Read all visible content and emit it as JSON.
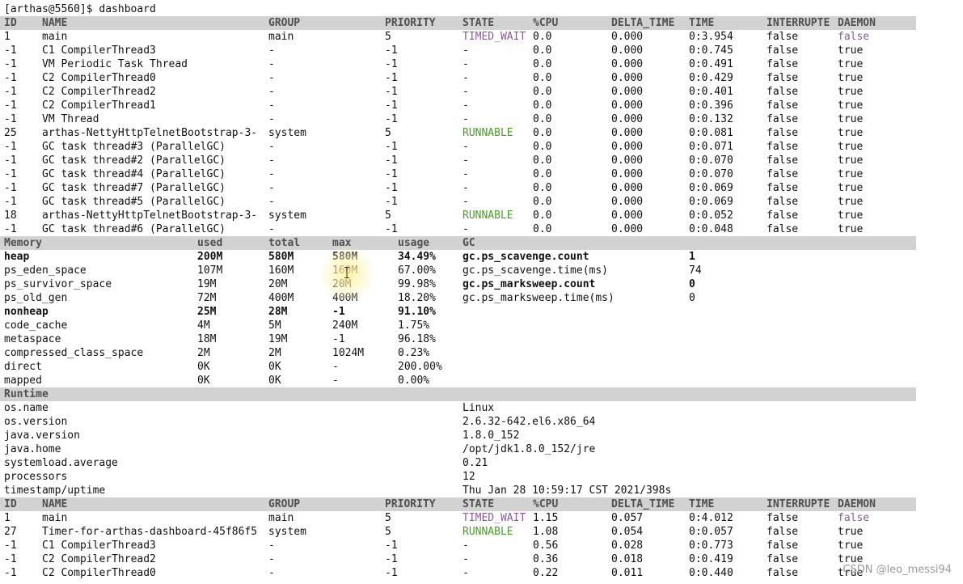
{
  "terminal": {
    "prompt": "[arthas@5560]$ dashboard"
  },
  "threads_top": {
    "headers": [
      "ID",
      "NAME",
      "GROUP",
      "PRIORITY",
      "STATE",
      "%CPU",
      "DELTA_TIME",
      "TIME",
      "INTERRUPTE",
      "DAEMON"
    ],
    "rows": [
      [
        "1",
        "main",
        "main",
        "5",
        "TIMED_WAIT",
        "0.0",
        "0.000",
        "0:3.954",
        "false",
        "false"
      ],
      [
        "-1",
        "C1 CompilerThread3",
        "-",
        "-1",
        "-",
        "0.0",
        "0.000",
        "0:0.745",
        "false",
        "true"
      ],
      [
        "-1",
        "VM Periodic Task Thread",
        "-",
        "-1",
        "-",
        "0.0",
        "0.000",
        "0:0.491",
        "false",
        "true"
      ],
      [
        "-1",
        "C2 CompilerThread0",
        "-",
        "-1",
        "-",
        "0.0",
        "0.000",
        "0:0.429",
        "false",
        "true"
      ],
      [
        "-1",
        "C2 CompilerThread2",
        "-",
        "-1",
        "-",
        "0.0",
        "0.000",
        "0:0.401",
        "false",
        "true"
      ],
      [
        "-1",
        "C2 CompilerThread1",
        "-",
        "-1",
        "-",
        "0.0",
        "0.000",
        "0:0.396",
        "false",
        "true"
      ],
      [
        "-1",
        "VM Thread",
        "-",
        "-1",
        "-",
        "0.0",
        "0.000",
        "0:0.132",
        "false",
        "true"
      ],
      [
        "25",
        "arthas-NettyHttpTelnetBootstrap-3-",
        "system",
        "5",
        "RUNNABLE",
        "0.0",
        "0.000",
        "0:0.081",
        "false",
        "true"
      ],
      [
        "-1",
        "GC task thread#3 (ParallelGC)",
        "-",
        "-1",
        "-",
        "0.0",
        "0.000",
        "0:0.071",
        "false",
        "true"
      ],
      [
        "-1",
        "GC task thread#2 (ParallelGC)",
        "-",
        "-1",
        "-",
        "0.0",
        "0.000",
        "0:0.070",
        "false",
        "true"
      ],
      [
        "-1",
        "GC task thread#4 (ParallelGC)",
        "-",
        "-1",
        "-",
        "0.0",
        "0.000",
        "0:0.070",
        "false",
        "true"
      ],
      [
        "-1",
        "GC task thread#7 (ParallelGC)",
        "-",
        "-1",
        "-",
        "0.0",
        "0.000",
        "0:0.069",
        "false",
        "true"
      ],
      [
        "-1",
        "GC task thread#5 (ParallelGC)",
        "-",
        "-1",
        "-",
        "0.0",
        "0.000",
        "0:0.069",
        "false",
        "true"
      ],
      [
        "18",
        "arthas-NettyHttpTelnetBootstrap-3-",
        "system",
        "5",
        "RUNNABLE",
        "0.0",
        "0.000",
        "0:0.052",
        "false",
        "true"
      ],
      [
        "-1",
        "GC task thread#6 (ParallelGC)",
        "-",
        "-1",
        "-",
        "0.0",
        "0.000",
        "0:0.048",
        "false",
        "true"
      ]
    ]
  },
  "memory": {
    "headers": [
      "Memory",
      "used",
      "total",
      "max",
      "usage",
      "GC"
    ],
    "rows": [
      {
        "cells": [
          "heap",
          "200M",
          "580M",
          "580M",
          "34.49%"
        ],
        "bold": true
      },
      {
        "cells": [
          "ps_eden_space",
          "107M",
          "160M",
          "160M",
          "67.00%"
        ],
        "bold": false
      },
      {
        "cells": [
          "ps_survivor_space",
          "19M",
          "20M",
          "20M",
          "99.98%"
        ],
        "bold": false
      },
      {
        "cells": [
          "ps_old_gen",
          "72M",
          "400M",
          "400M",
          "18.20%"
        ],
        "bold": false
      },
      {
        "cells": [
          "nonheap",
          "25M",
          "28M",
          "-1",
          "91.10%"
        ],
        "bold": true
      },
      {
        "cells": [
          "code_cache",
          "4M",
          "5M",
          "240M",
          "1.75%"
        ],
        "bold": false
      },
      {
        "cells": [
          "metaspace",
          "18M",
          "19M",
          "-1",
          "96.18%"
        ],
        "bold": false
      },
      {
        "cells": [
          "compressed_class_space",
          "2M",
          "2M",
          "1024M",
          "0.23%"
        ],
        "bold": false
      },
      {
        "cells": [
          "direct",
          "0K",
          "0K",
          "-",
          "200.00%"
        ],
        "bold": false
      },
      {
        "cells": [
          "mapped",
          "0K",
          "0K",
          "-",
          "0.00%"
        ],
        "bold": false
      }
    ],
    "gc": [
      {
        "name": "gc.ps_scavenge.count",
        "value": "1",
        "bold": true
      },
      {
        "name": "gc.ps_scavenge.time(ms)",
        "value": "74",
        "bold": false
      },
      {
        "name": "gc.ps_marksweep.count",
        "value": "0",
        "bold": true
      },
      {
        "name": "gc.ps_marksweep.time(ms)",
        "value": "0",
        "bold": false
      }
    ]
  },
  "runtime": {
    "header": "Runtime",
    "rows": [
      [
        "os.name",
        "Linux"
      ],
      [
        "os.version",
        "2.6.32-642.el6.x86_64"
      ],
      [
        "java.version",
        "1.8.0_152"
      ],
      [
        "java.home",
        "/opt/jdk1.8.0_152/jre"
      ],
      [
        "systemload.average",
        "0.21"
      ],
      [
        "processors",
        "12"
      ],
      [
        "timestamp/uptime",
        "Thu Jan 28 10:59:17 CST 2021/398s"
      ]
    ]
  },
  "threads_bottom": {
    "headers": [
      "ID",
      "NAME",
      "GROUP",
      "PRIORITY",
      "STATE",
      "%CPU",
      "DELTA_TIME",
      "TIME",
      "INTERRUPTE",
      "DAEMON"
    ],
    "rows": [
      [
        "1",
        "main",
        "main",
        "5",
        "TIMED_WAIT",
        "1.15",
        "0.057",
        "0:4.012",
        "false",
        "false"
      ],
      [
        "27",
        "Timer-for-arthas-dashboard-45f86f5",
        "system",
        "5",
        "RUNNABLE",
        "1.08",
        "0.054",
        "0:0.057",
        "false",
        "true"
      ],
      [
        "-1",
        "C1 CompilerThread3",
        "-",
        "-1",
        "-",
        "0.56",
        "0.028",
        "0:0.773",
        "false",
        "true"
      ],
      [
        "-1",
        "C2 CompilerThread2",
        "-",
        "-1",
        "-",
        "0.36",
        "0.018",
        "0:0.419",
        "false",
        "true"
      ],
      [
        "-1",
        "C2 CompilerThread0",
        "-",
        "-1",
        "-",
        "0.22",
        "0.011",
        "0:0.440",
        "false",
        "true"
      ]
    ]
  },
  "colors": {
    "header_bg": "#d2d2d2",
    "timed_wait": "#8a5a94",
    "runnable": "#4c9a2a",
    "daemon_false": "#8a5a94"
  },
  "watermark": "CSDN @leo_messi94"
}
